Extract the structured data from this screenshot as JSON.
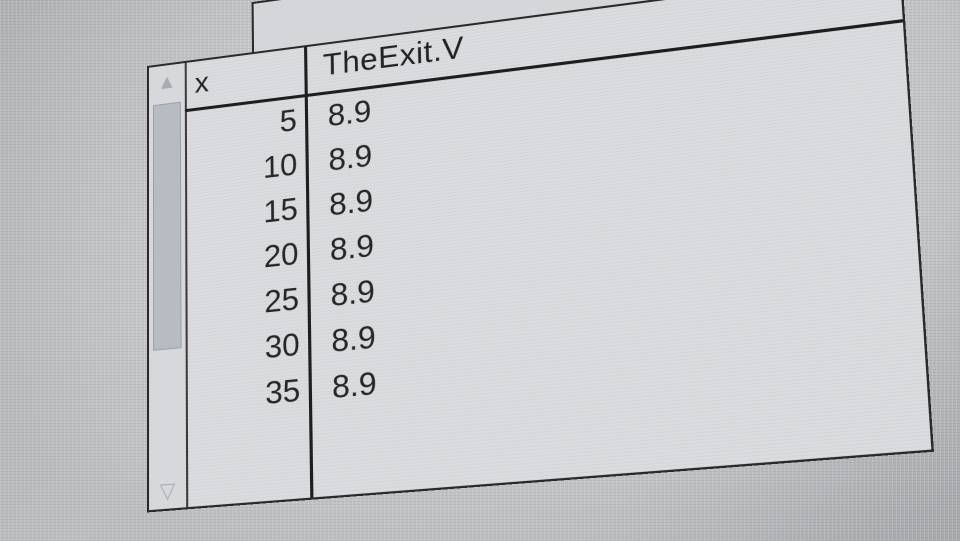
{
  "table": {
    "columns": {
      "x": "x",
      "value": "TheExit.V"
    },
    "rows": [
      {
        "x": "5",
        "value": "8.9"
      },
      {
        "x": "10",
        "value": "8.9"
      },
      {
        "x": "15",
        "value": "8.9"
      },
      {
        "x": "20",
        "value": "8.9"
      },
      {
        "x": "25",
        "value": "8.9"
      },
      {
        "x": "30",
        "value": "8.9"
      },
      {
        "x": "35",
        "value": "8.9"
      }
    ]
  },
  "scrollbar": {
    "up_icon": "triangle-up-icon",
    "down_icon": "triangle-down-icon"
  }
}
